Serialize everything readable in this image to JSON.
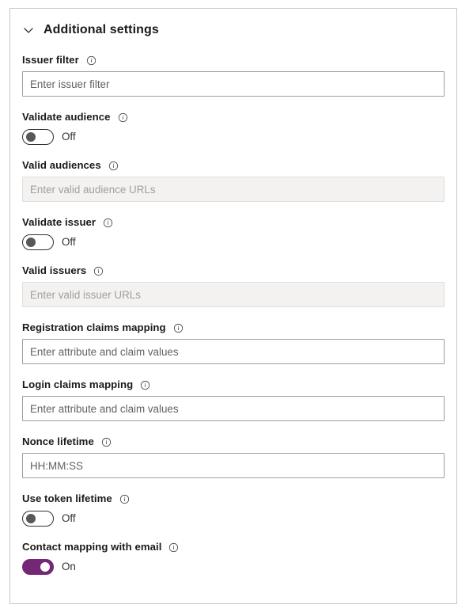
{
  "panel": {
    "header": {
      "title": "Additional settings",
      "chevron_icon": "chevron-down-icon",
      "expanded": true
    },
    "info_icon": "info-circle-icon",
    "accent_color": "#742774",
    "fields": [
      {
        "id": "issuer-filter",
        "type": "text",
        "label": "Issuer filter",
        "placeholder": "Enter issuer filter",
        "value": "",
        "disabled": false,
        "has_info": true
      },
      {
        "id": "validate-audience",
        "type": "toggle",
        "label": "Validate audience",
        "state_label": "Off",
        "on": false,
        "has_info": true
      },
      {
        "id": "valid-audiences",
        "type": "text",
        "label": "Valid audiences",
        "placeholder": "Enter valid audience URLs",
        "value": "",
        "disabled": true,
        "has_info": true
      },
      {
        "id": "validate-issuer",
        "type": "toggle",
        "label": "Validate issuer",
        "state_label": "Off",
        "on": false,
        "has_info": true
      },
      {
        "id": "valid-issuers",
        "type": "text",
        "label": "Valid issuers",
        "placeholder": "Enter valid issuer URLs",
        "value": "",
        "disabled": true,
        "has_info": true
      },
      {
        "id": "registration-claims-mapping",
        "type": "text",
        "label": "Registration claims mapping",
        "placeholder": "Enter attribute and claim values",
        "value": "",
        "disabled": false,
        "has_info": true
      },
      {
        "id": "login-claims-mapping",
        "type": "text",
        "label": "Login claims mapping",
        "placeholder": "Enter attribute and claim values",
        "value": "",
        "disabled": false,
        "has_info": true
      },
      {
        "id": "nonce-lifetime",
        "type": "text",
        "label": "Nonce lifetime",
        "placeholder": "HH:MM:SS",
        "value": "",
        "disabled": false,
        "has_info": true
      },
      {
        "id": "use-token-lifetime",
        "type": "toggle",
        "label": "Use token lifetime",
        "state_label": "Off",
        "on": false,
        "has_info": true
      },
      {
        "id": "contact-mapping-with-email",
        "type": "toggle",
        "label": "Contact mapping with email",
        "state_label": "On",
        "on": true,
        "has_info": true
      }
    ]
  }
}
